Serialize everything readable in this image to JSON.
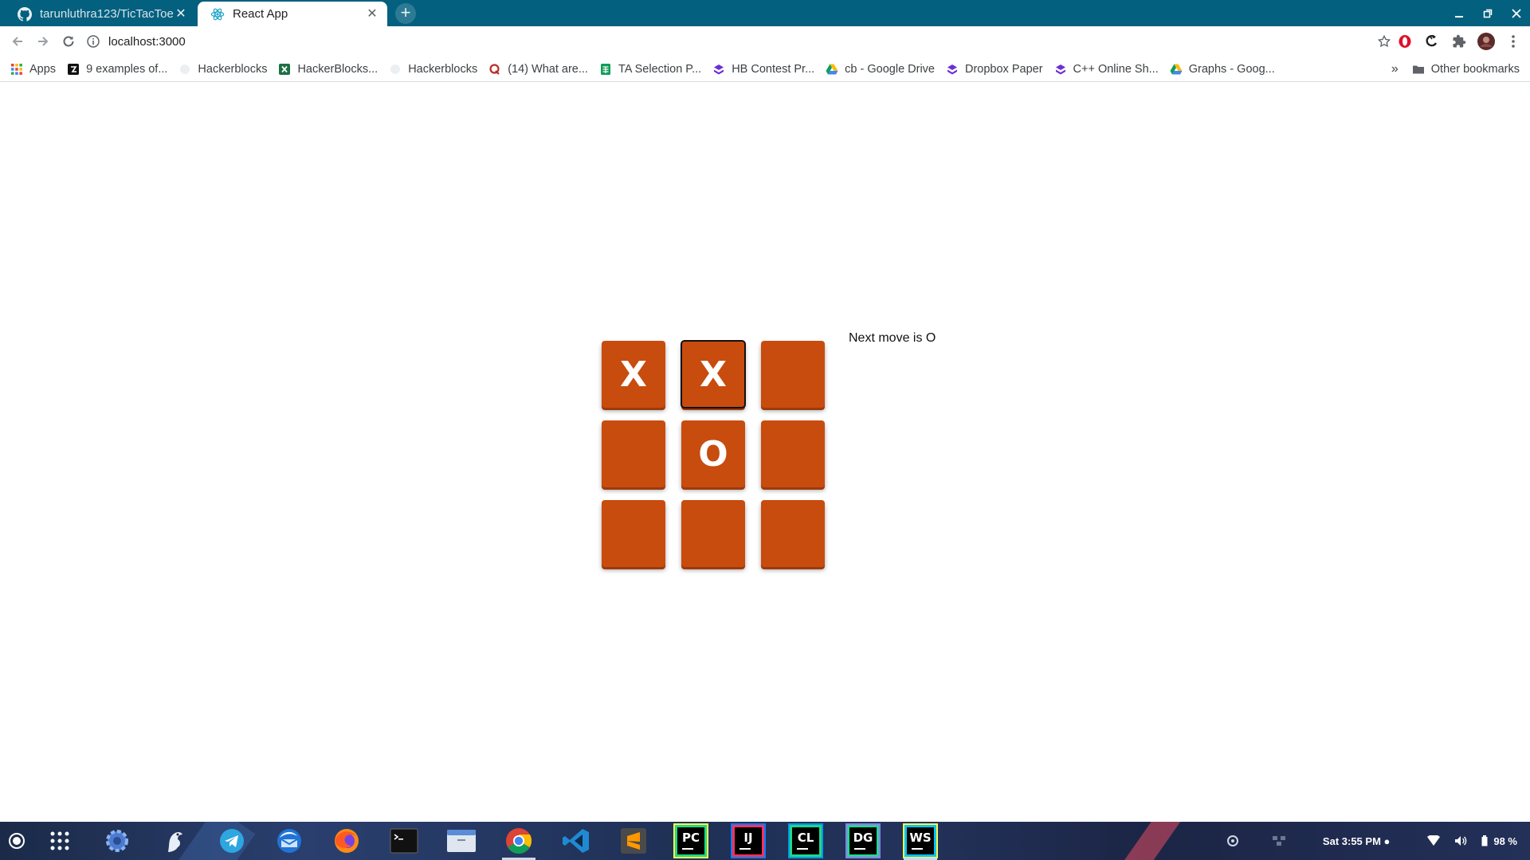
{
  "browser": {
    "tabs": [
      {
        "title": "tarunluthra123/TicTacToe",
        "favicon": "github-icon",
        "active": false
      },
      {
        "title": "React App",
        "favicon": "react-icon",
        "active": true
      }
    ],
    "url": "localhost:3000"
  },
  "bookmarks": {
    "items": [
      {
        "label": "Apps",
        "icon": "apps-grid-icon"
      },
      {
        "label": "9 examples of...",
        "icon": "bookmark-black-icon"
      },
      {
        "label": "Hackerblocks",
        "icon": "bookmark-faded-icon"
      },
      {
        "label": "HackerBlocks...",
        "icon": "excel-icon"
      },
      {
        "label": "Hackerblocks",
        "icon": "bookmark-faded-icon"
      },
      {
        "label": "(14) What are...",
        "icon": "quora-icon"
      },
      {
        "label": "TA Selection P...",
        "icon": "sheets-icon"
      },
      {
        "label": "HB Contest Pr...",
        "icon": "dropbox-paper-icon"
      },
      {
        "label": "cb - Google Drive",
        "icon": "drive-icon"
      },
      {
        "label": "Dropbox Paper",
        "icon": "dropbox-paper-icon"
      },
      {
        "label": "C++ Online Sh...",
        "icon": "dropbox-paper-icon"
      },
      {
        "label": "Graphs - Goog...",
        "icon": "drive-icon"
      }
    ],
    "more": "»",
    "other": "Other bookmarks"
  },
  "game": {
    "squares": [
      "X",
      "X",
      "",
      "",
      "O",
      "",
      "",
      "",
      ""
    ],
    "status": "Next move is O",
    "square_color": "#c84c0e"
  },
  "taskbar": {
    "clock": "Sat  3:55 PM ●",
    "battery": "98 %"
  }
}
